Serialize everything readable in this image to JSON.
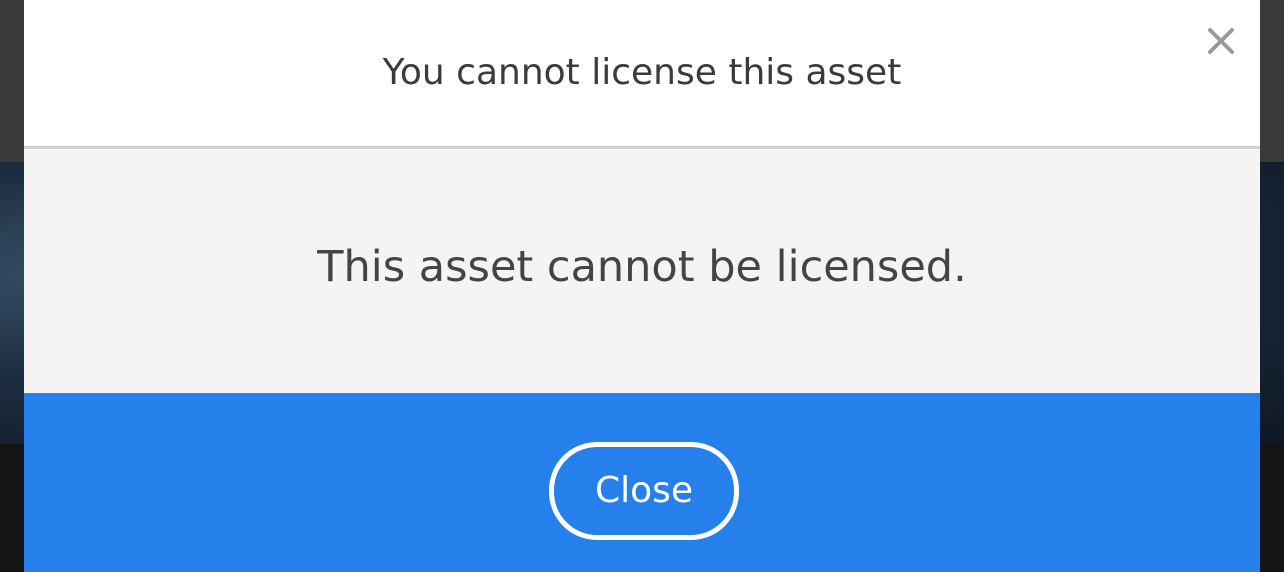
{
  "dialog": {
    "title": "You cannot license this asset",
    "message": "This asset cannot be licensed.",
    "close_button_label": "Close",
    "close_icon": "close-x-icon"
  },
  "colors": {
    "footer_blue": "#2680eb",
    "header_white": "#ffffff",
    "body_gray": "#f4f4f4",
    "text_dark": "#3b3b3b"
  }
}
